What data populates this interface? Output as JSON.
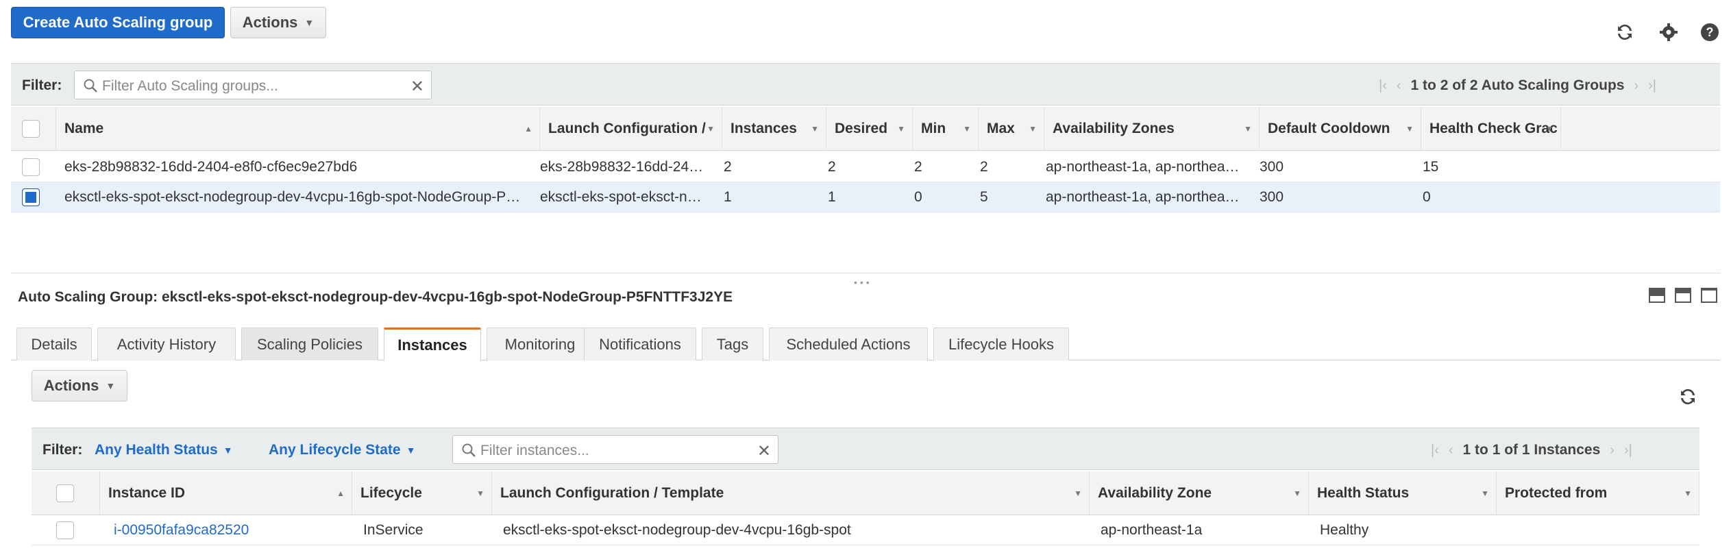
{
  "toolbar": {
    "create_label": "Create Auto Scaling group",
    "actions_label": "Actions"
  },
  "icons": {
    "refresh": "refresh-icon",
    "settings": "gear-icon",
    "help": "help-icon"
  },
  "groups_filter": {
    "label": "Filter:",
    "placeholder": "Filter Auto Scaling groups...",
    "pager_text": "1 to 2 of 2 Auto Scaling Groups"
  },
  "groups_table": {
    "columns": [
      "Name",
      "Launch Configuration /",
      "Instances",
      "Desired",
      "Min",
      "Max",
      "Availability Zones",
      "Default Cooldown",
      "Health Check Grac"
    ],
    "rows": [
      {
        "name": "eks-28b98832-16dd-2404-e8f0-cf6ec9e27bd6",
        "launch": "eks-28b98832-16dd-24…",
        "instances": "2",
        "desired": "2",
        "min": "2",
        "max": "2",
        "zones": "ap-northeast-1a, ap-northea…",
        "cooldown": "300",
        "grace": "15",
        "selected": false
      },
      {
        "name": "eksctl-eks-spot-eksct-nodegroup-dev-4vcpu-16gb-spot-NodeGroup-P…",
        "launch": "eksctl-eks-spot-eksct-n…",
        "instances": "1",
        "desired": "1",
        "min": "0",
        "max": "5",
        "zones": "ap-northeast-1a, ap-northea…",
        "cooldown": "300",
        "grace": "0",
        "selected": true
      }
    ]
  },
  "detail": {
    "title": "Auto Scaling Group: eksctl-eks-spot-eksct-nodegroup-dev-4vcpu-16gb-spot-NodeGroup-P5FNTTF3J2YE",
    "tabs": [
      "Details",
      "Activity History",
      "Scaling Policies",
      "Instances",
      "Monitoring",
      "Notifications",
      "Tags",
      "Scheduled Actions",
      "Lifecycle Hooks"
    ],
    "active_tab": "Instances",
    "actions_label": "Actions"
  },
  "instances_filter": {
    "label": "Filter:",
    "health_dropdown": "Any Health Status",
    "lifecycle_dropdown": "Any Lifecycle State",
    "placeholder": "Filter instances...",
    "pager_text": "1 to 1 of 1 Instances"
  },
  "instances_table": {
    "columns": [
      "Instance ID",
      "Lifecycle",
      "Launch Configuration / Template",
      "Availability Zone",
      "Health Status",
      "Protected from"
    ],
    "rows": [
      {
        "id": "i-00950fafa9ca82520",
        "lifecycle": "InService",
        "launch": "eksctl-eks-spot-eksct-nodegroup-dev-4vcpu-16gb-spot",
        "zone": "ap-northeast-1a",
        "health": "Healthy",
        "protected": ""
      }
    ]
  },
  "colors": {
    "primary": "#1f6bc9",
    "active_tab_accent": "#ec7211",
    "selected_row": "#e8f1fa"
  }
}
